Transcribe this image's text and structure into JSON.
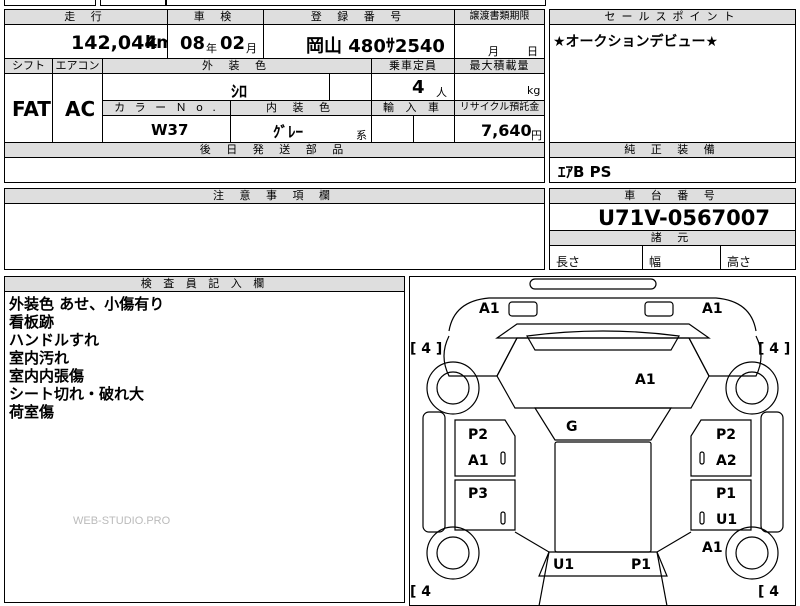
{
  "header": {
    "mileage_label": "走 行",
    "inspection_label": "車 検",
    "reg_label": "登 録 番 号",
    "transfer_label": "譲渡書類期限",
    "sale_label": "セールスポイント",
    "mileage_value": "142,044",
    "mileage_unit": "km",
    "inspect_year": "08",
    "inspect_year_unit": "年",
    "inspect_month": "02",
    "inspect_month_unit": "月",
    "reg_number": "岡山 480ｻ2540",
    "transfer_month": "月",
    "transfer_day": "日",
    "sale_point": "★オークションデビュー★"
  },
  "spec": {
    "shift_label": "シフト",
    "ac_label": "エアコン",
    "ext_color_label": "外 装 色",
    "capacity_label": "乗車定員",
    "max_load_label": "最大積載量",
    "shift_value": "FAT",
    "ac_value": "AC",
    "ext_color_value": "ｼﾛ",
    "capacity_value": "4",
    "capacity_unit": "人",
    "max_load_unit": "kg",
    "color_no_label": "カ ラ ー Ｎ o .",
    "int_color_label": "内 装 色",
    "import_label": "輸 入 車",
    "recycle_label": "リサイクル預託金",
    "color_no_value": "W37",
    "int_color_value": "ｸﾞﾚｰ",
    "int_color_suffix": "系",
    "recycle_value": "7,640",
    "recycle_unit": "円",
    "delivery_label": "後 日 発 送 部 品",
    "genuine_label": "純 正 装 備",
    "genuine_value": "ｴｱB PS"
  },
  "notes": {
    "caution_label": "注 意 事 項 欄",
    "chassis_label": "車 台 番 号",
    "chassis_value": "U71V-0567007",
    "dims_label": "諸 元",
    "length_label": "長さ",
    "width_label": "幅",
    "height_label": "高さ"
  },
  "inspector": {
    "label": "検 査 員 記 入 欄",
    "lines": [
      "外装色 あせ、小傷有り",
      "看板跡",
      "ハンドルすれ",
      "室内汚れ",
      "室内内張傷",
      "シート切れ・破れ大",
      "荷室傷"
    ],
    "watermark": "WEB-STUDIO.PRO"
  },
  "diagram": {
    "tire_fl": "[ 4 ]",
    "tire_fr": "[ 4 ]",
    "tire_rl": "[ 4",
    "tire_rr": "[ 4",
    "marks": {
      "a1_top_left": "A1",
      "a1_top_right": "A1",
      "a1_hood": "A1",
      "g_windshield": "G",
      "p2_left": "P2",
      "a1_left_front_door": "A1",
      "p2_right": "P2",
      "a2_right_front_door": "A2",
      "p3_left": "P3",
      "p1_right": "P1",
      "u1_right": "U1",
      "a1_right_rear": "A1",
      "u1_rear": "U1",
      "p1_rear": "P1"
    }
  }
}
